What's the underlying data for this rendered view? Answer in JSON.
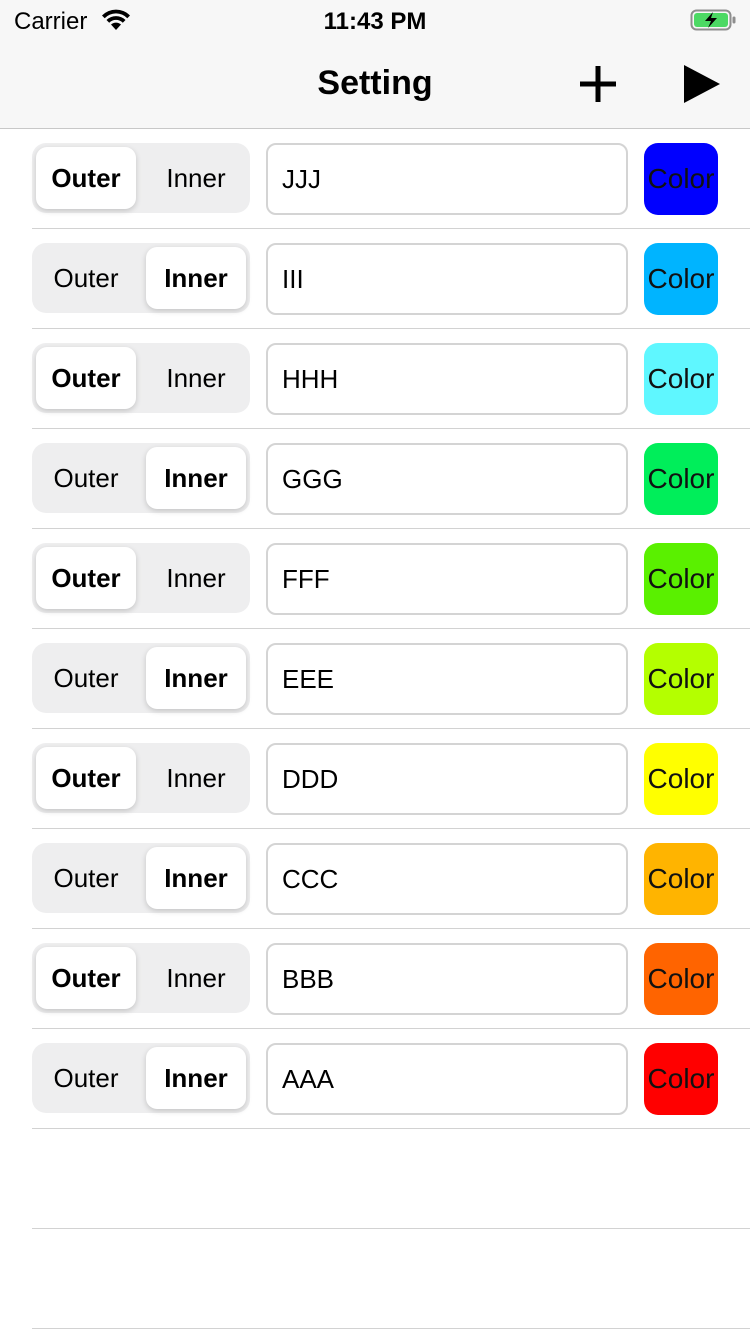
{
  "status_bar": {
    "carrier": "Carrier",
    "time": "11:43 PM",
    "wifi_icon": "wifi-icon",
    "battery_icon": "battery-charging-icon"
  },
  "nav": {
    "title": "Setting",
    "add_icon": "plus-icon",
    "play_icon": "play-icon"
  },
  "segment_labels": {
    "outer": "Outer",
    "inner": "Inner"
  },
  "color_label": "Color",
  "rows": [
    {
      "selected": "outer",
      "name": "JJJ",
      "color": "#0000ff"
    },
    {
      "selected": "inner",
      "name": "III",
      "color": "#00b4ff"
    },
    {
      "selected": "outer",
      "name": "HHH",
      "color": "#5ff7ff"
    },
    {
      "selected": "inner",
      "name": "GGG",
      "color": "#00ee5a"
    },
    {
      "selected": "outer",
      "name": "FFF",
      "color": "#5af000"
    },
    {
      "selected": "inner",
      "name": "EEE",
      "color": "#b4ff00"
    },
    {
      "selected": "outer",
      "name": "DDD",
      "color": "#ffff00"
    },
    {
      "selected": "inner",
      "name": "CCC",
      "color": "#ffb400"
    },
    {
      "selected": "outer",
      "name": "BBB",
      "color": "#ff6400"
    },
    {
      "selected": "inner",
      "name": "AAA",
      "color": "#ff0000"
    }
  ],
  "empty_rows": 2
}
